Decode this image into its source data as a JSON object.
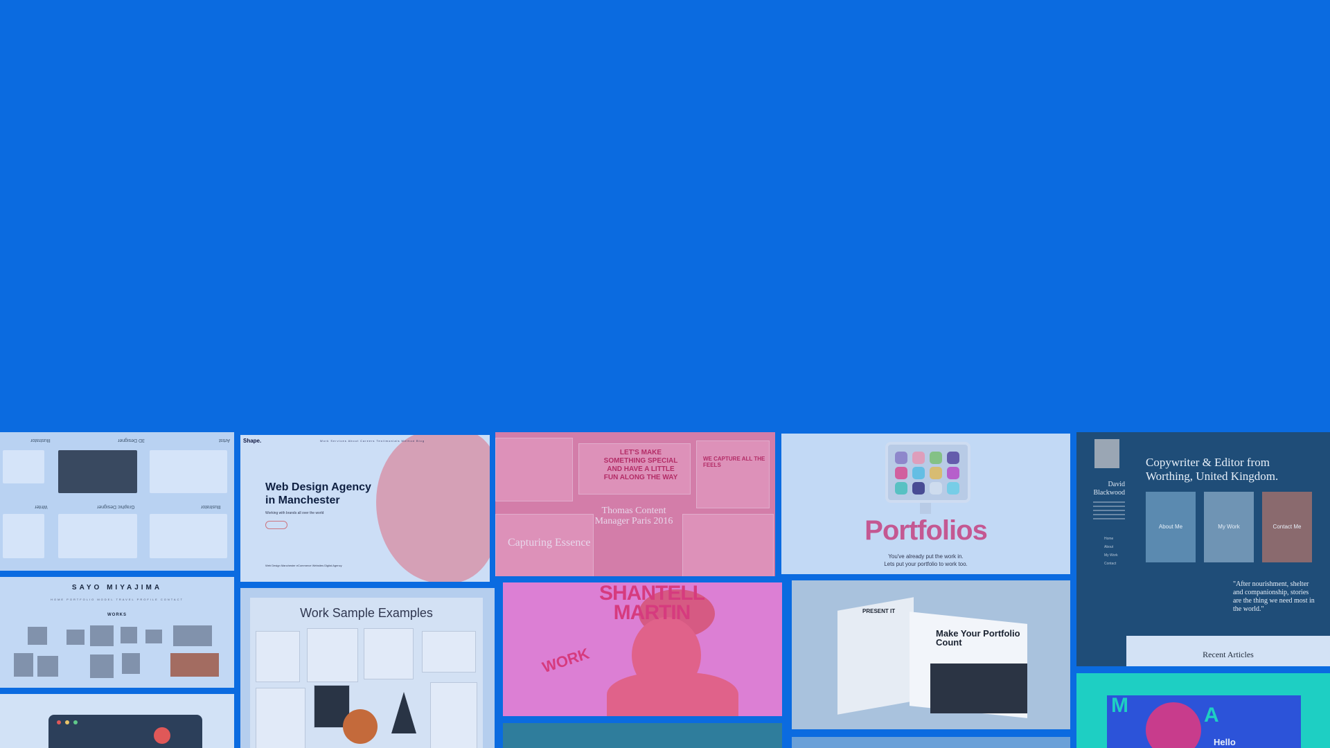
{
  "colors": {
    "hero": "#0b6be0",
    "pink_accent": "#d4578b"
  },
  "tiles": {
    "art_grid": {
      "labels": [
        "Illustrator",
        "3D Designer",
        "Artist",
        "Writer",
        "Graphic Designer",
        "Illustrator"
      ]
    },
    "shape_agency": {
      "logo": "Shape.",
      "nav": "Work   Services   About   Careers   Testimonials   Method   Blog",
      "headline": "Web Design Agency in Manchester",
      "subline": "Working with brands all over the world",
      "footer": "Web Design Manchester        eCommerce Websites        Digital Agency"
    },
    "pink_collage": {
      "headline": "LET'S MAKE SOMETHING SPECIAL AND HAVE A LITTLE FUN ALONG THE WAY",
      "name": "Thomas Content Manager Paris 2016",
      "caption": "Capturing Essence",
      "side": "WE CAPTURE ALL THE FEELS"
    },
    "portfolios": {
      "title": "Portfolios",
      "tagline_1": "You've already put the work in.",
      "tagline_2": "Lets put your portfolio to work too.",
      "icons": [
        "grape-app-icon",
        "peach-app-icon",
        "green-app-icon",
        "purple-app-icon",
        "pink-app-icon",
        "cyan-app-icon",
        "gold-app-icon",
        "magenta-app-icon",
        "teal-app-icon",
        "indigo-app-icon",
        "silver-app-icon",
        "aqua-app-icon"
      ]
    },
    "copywriter": {
      "name": "David Blackwood",
      "headline": "Copywriter & Editor from Worthing, United Kingdom.",
      "cards": [
        "About Me",
        "My Work",
        "Contact Me"
      ],
      "links": [
        "Home",
        "About",
        "My Work",
        "Contact"
      ],
      "quote": "\"After nourishment, shelter and companionship, stories are the thing we need most in the world.\"",
      "recent": "Recent Articles"
    },
    "sayo": {
      "name": "SAYO MIYAJIMA",
      "nav": "HOME  PORTFOLIO  MODEL  TRAVEL  PROFILE  CONTACT",
      "works": "WORKS"
    },
    "work_samples": {
      "title": "Work Sample Examples"
    },
    "shantell": {
      "headline": "SHANTELL MARTIN",
      "work": "WORK"
    },
    "magazine": {
      "headline": "Make Your Portfolio Count",
      "kicker": "PRESENT IT"
    },
    "moa": {
      "letter_m": "M",
      "letter_a": "A",
      "hello": "Hello"
    }
  }
}
